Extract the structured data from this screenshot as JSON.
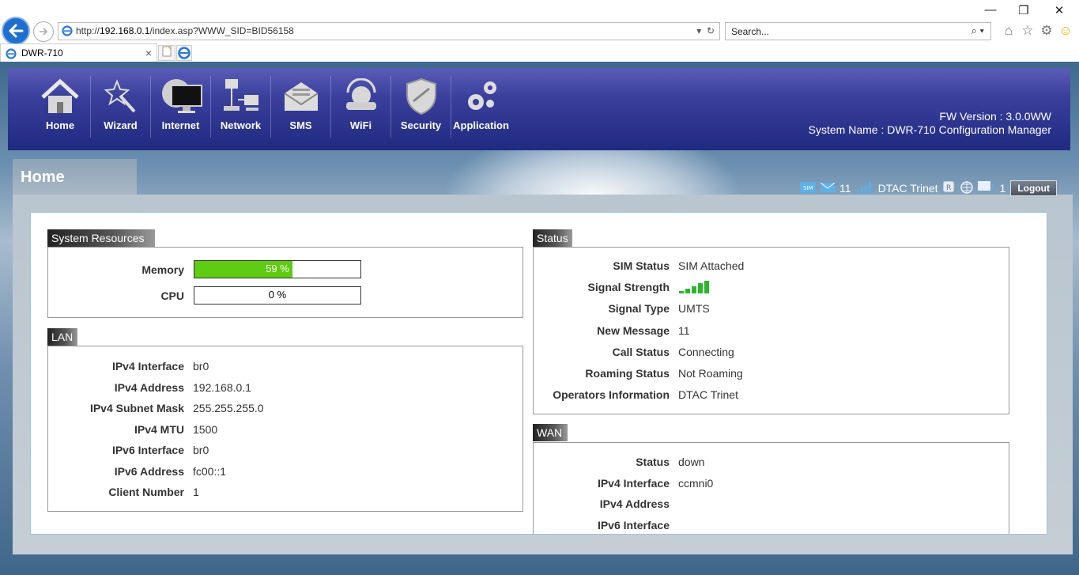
{
  "browser": {
    "url_prefix": "http://",
    "url_host": "192.168.0.1",
    "url_path": "/index.asp?WWW_SID=BID56158",
    "search_placeholder": "Search...",
    "tab_title": "DWR-710",
    "tab_close": "×"
  },
  "nav": {
    "items": [
      {
        "label": "Home",
        "icon": "house-icon"
      },
      {
        "label": "Wizard",
        "icon": "wand-icon"
      },
      {
        "label": "Internet",
        "icon": "globe-monitor-icon"
      },
      {
        "label": "Network",
        "icon": "network-icon"
      },
      {
        "label": "SMS",
        "icon": "envelope-icon"
      },
      {
        "label": "WiFi",
        "icon": "router-icon"
      },
      {
        "label": "Security",
        "icon": "shield-icon"
      },
      {
        "label": "Application",
        "icon": "gears-icon"
      }
    ]
  },
  "header": {
    "fw_version": "FW Version : 3.0.0WW",
    "system_name": "System Name : DWR-710 Configuration Manager"
  },
  "page": {
    "title": "Home"
  },
  "status_bar": {
    "message_count": "11",
    "operator": "DTAC Trinet",
    "client_count": "1",
    "logout_label": "Logout"
  },
  "system_resources": {
    "title": "System Resources",
    "memory_label": "Memory",
    "memory_value": "59 %",
    "memory_percent": 59,
    "cpu_label": "CPU",
    "cpu_value": "0 %",
    "cpu_percent": 0
  },
  "lan": {
    "title": "LAN",
    "rows": [
      {
        "k": "IPv4 Interface",
        "v": "br0"
      },
      {
        "k": "IPv4 Address",
        "v": "192.168.0.1"
      },
      {
        "k": "IPv4 Subnet Mask",
        "v": "255.255.255.0"
      },
      {
        "k": "IPv4 MTU",
        "v": "1500"
      },
      {
        "k": "IPv6 Interface",
        "v": "br0"
      },
      {
        "k": "IPv6 Address",
        "v": "fc00::1"
      },
      {
        "k": "Client Number",
        "v": "1"
      }
    ]
  },
  "status": {
    "title": "Status",
    "rows": [
      {
        "k": "SIM Status",
        "v": "SIM Attached"
      },
      {
        "k": "Signal Strength",
        "v": ""
      },
      {
        "k": "Signal Type",
        "v": "UMTS"
      },
      {
        "k": "New Message",
        "v": "11"
      },
      {
        "k": "Call Status",
        "v": "Connecting"
      },
      {
        "k": "Roaming Status",
        "v": "Not Roaming"
      },
      {
        "k": "Operators Information",
        "v": "DTAC Trinet"
      }
    ]
  },
  "wan": {
    "title": "WAN",
    "rows": [
      {
        "k": "Status",
        "v": "down"
      },
      {
        "k": "IPv4 Interface",
        "v": "ccmni0"
      },
      {
        "k": "IPv4 Address",
        "v": ""
      },
      {
        "k": "IPv6 Interface",
        "v": ""
      }
    ]
  },
  "colors": {
    "accent_blue": "#1f6fd1",
    "bar_green": "#5dcc12",
    "header_blue": "#2b3390"
  }
}
